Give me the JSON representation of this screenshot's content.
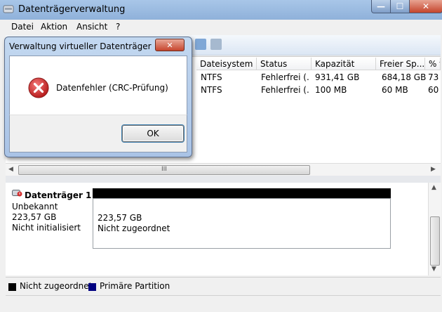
{
  "window": {
    "title": "Datenträgerverwaltung",
    "min_glyph": "—",
    "max_glyph": "☐",
    "close_glyph": "✕",
    "app_icon": "disk-management-icon"
  },
  "menu": [
    "Datei",
    "Aktion",
    "Ansicht",
    "?"
  ],
  "volume_list": {
    "columns": [
      "Dateisystem",
      "Status",
      "Kapazität",
      "Freier Sp...",
      "% f"
    ],
    "rows": [
      [
        "NTFS",
        "Fehlerfrei (...",
        "931,41 GB",
        "684,18 GB",
        "73"
      ],
      [
        "NTFS",
        "Fehlerfrei (...",
        "100 MB",
        "60 MB",
        "60"
      ]
    ],
    "scroll_grip": "III"
  },
  "disk": {
    "name": "Datenträger 1",
    "status": "Unbekannt",
    "size": "223,57 GB",
    "init_state": "Nicht initialisiert",
    "partition": {
      "size": "223,57 GB",
      "label": "Nicht zugeordnet"
    }
  },
  "legend": [
    {
      "label": "Nicht zugeordnet",
      "color": "#000000"
    },
    {
      "label": "Primäre Partition",
      "color": "#000080"
    }
  ],
  "dialog": {
    "title": "Verwaltung virtueller Datenträger",
    "close_glyph": "✕",
    "icon": "error-icon",
    "message": "Datenfehler (CRC-Prüfung)",
    "ok_label": "OK"
  },
  "colors": {
    "titlebar": "#a8c6e8",
    "error_red": "#d32f2f",
    "unallocated": "#000000",
    "primary_partition": "#000080"
  }
}
